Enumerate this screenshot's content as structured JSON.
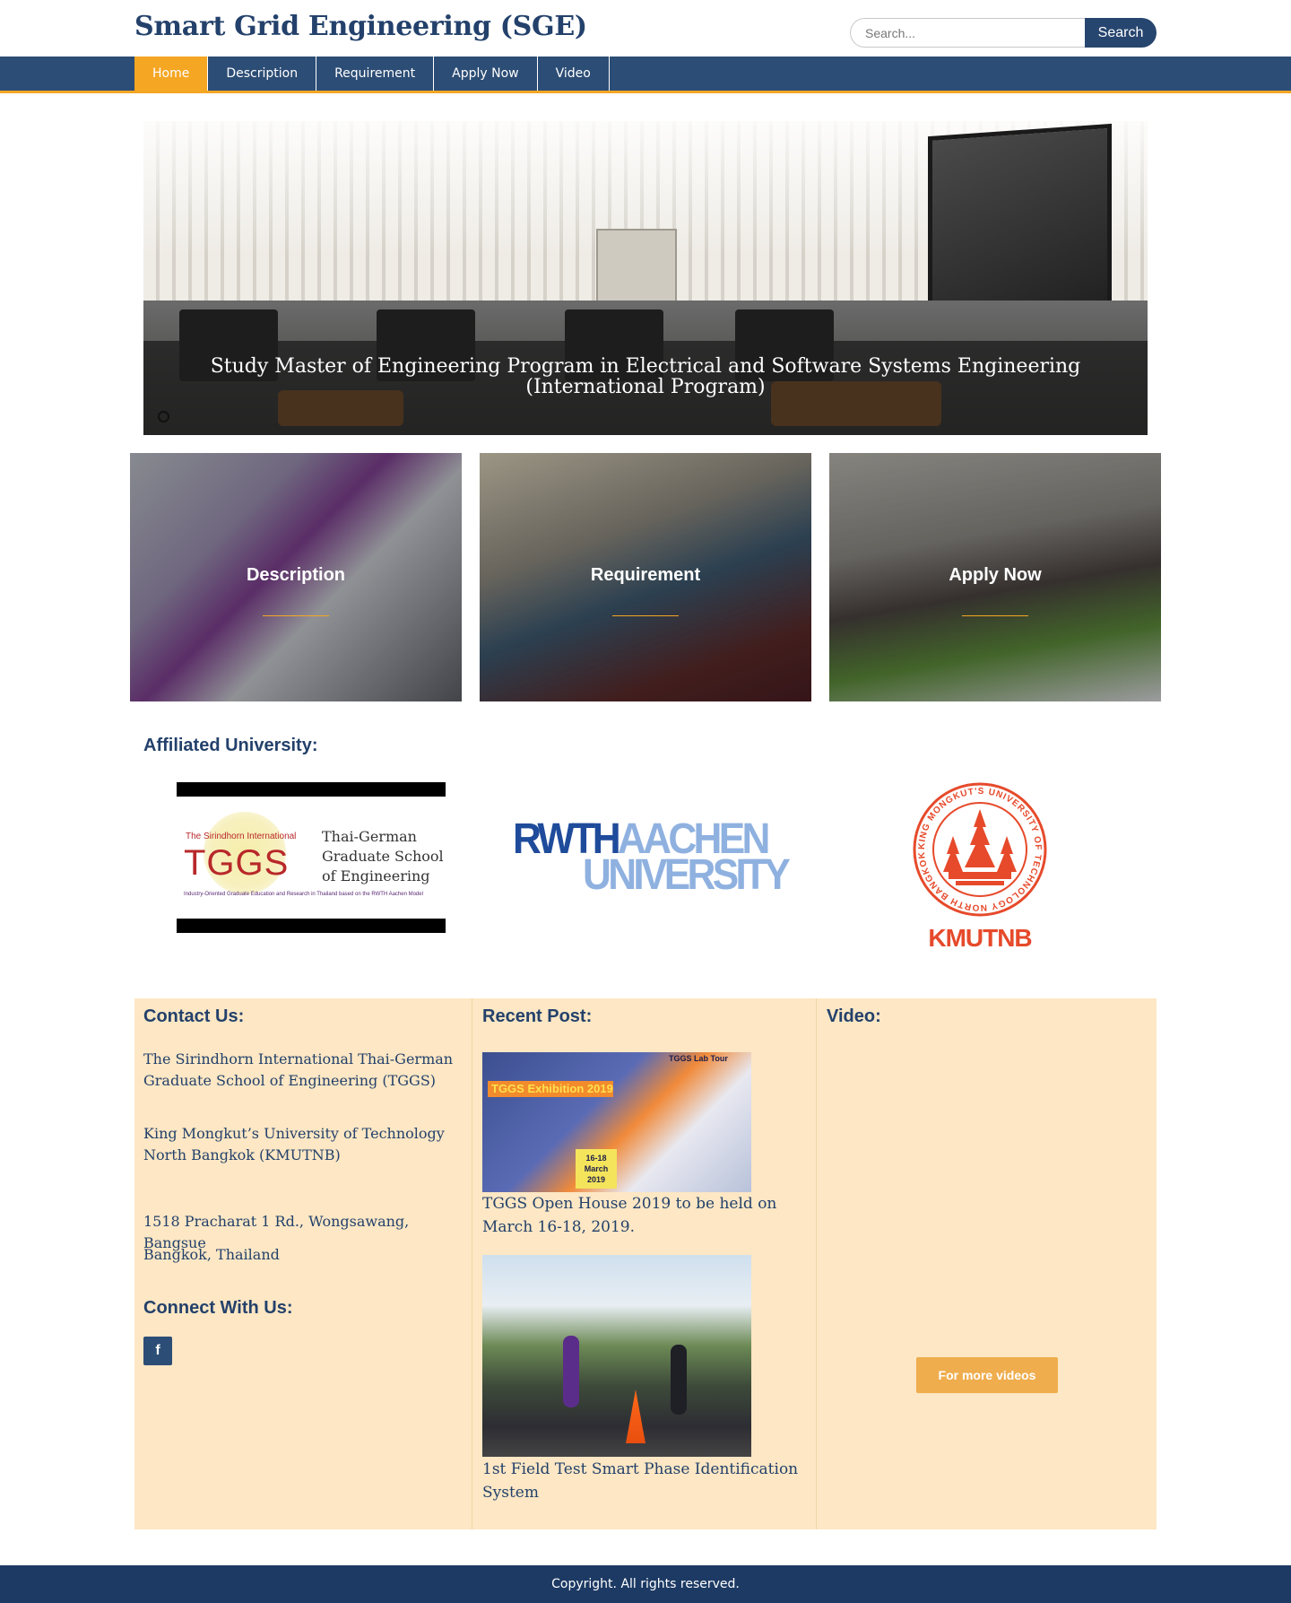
{
  "site": {
    "title": "Smart Grid Engineering (SGE)"
  },
  "search": {
    "placeholder": "Search...",
    "button_label": "Search"
  },
  "nav": {
    "items": [
      {
        "label": "Home",
        "active": true
      },
      {
        "label": "Description",
        "active": false
      },
      {
        "label": "Requirement",
        "active": false
      },
      {
        "label": "Apply Now",
        "active": false
      },
      {
        "label": "Video",
        "active": false
      }
    ]
  },
  "hero": {
    "caption": "Study Master of Engineering Program in Electrical and Software Systems Engineering (International Program)"
  },
  "cards": [
    {
      "label": "Description"
    },
    {
      "label": "Requirement"
    },
    {
      "label": "Apply Now"
    }
  ],
  "affiliated": {
    "title": "Affiliated University:",
    "tggs": {
      "small": "The Sirindhorn International",
      "big": "TGGS",
      "right_line1": "Thai-German",
      "right_line2": "Graduate School",
      "right_line3": "of Engineering",
      "tagline": "Industry-Oriented Graduate Education and Research in Thailand based on the RWTH Aachen Model"
    },
    "rwth": {
      "part1": "RWTH",
      "part2": "AACHEN",
      "part3": "UNIVERSITY"
    },
    "kmutnb": {
      "name": "KMUTNB",
      "seal_text": "KING MONGKUT'S UNIVERSITY OF TECHNOLOGY NORTH BANGKOK"
    }
  },
  "contact": {
    "title": "Contact Us:",
    "line1": "The Sirindhorn International Thai-German Graduate School of Engineering (TGGS)",
    "line2": "King Mongkut’s University of Technology North Bangkok (KMUTNB)",
    "address1": "1518 Pracharat 1 Rd., Wongsawang, Bangsue",
    "address2": "Bangkok, Thailand",
    "connect_title": "Connect With Us:",
    "facebook_icon_glyph": "f"
  },
  "recent": {
    "title": "Recent Post:",
    "posts": [
      {
        "title": "TGGS Open House 2019 to be held on March 16-18, 2019.",
        "poster_heading": "TGGS Exhibition 2019",
        "poster_lab_tour": "TGGS Lab Tour",
        "poster_date": "16-18 March 2019"
      },
      {
        "title": "1st Field Test Smart Phase Identification System"
      }
    ]
  },
  "video": {
    "title": "Video:",
    "more_label": "For more videos"
  },
  "footer": {
    "copyright": "Copyright. All rights reserved."
  },
  "colors": {
    "brand_navy": "#23416b",
    "nav_bg": "#2c4d75",
    "accent_orange": "#f5a623",
    "widget_bg": "#fde7c4",
    "footer_bg": "#1d3a64",
    "kmutnb_red": "#e64a2b",
    "rwth_dark_blue": "#1f4b9b",
    "rwth_light_blue": "#8fb1e0"
  }
}
